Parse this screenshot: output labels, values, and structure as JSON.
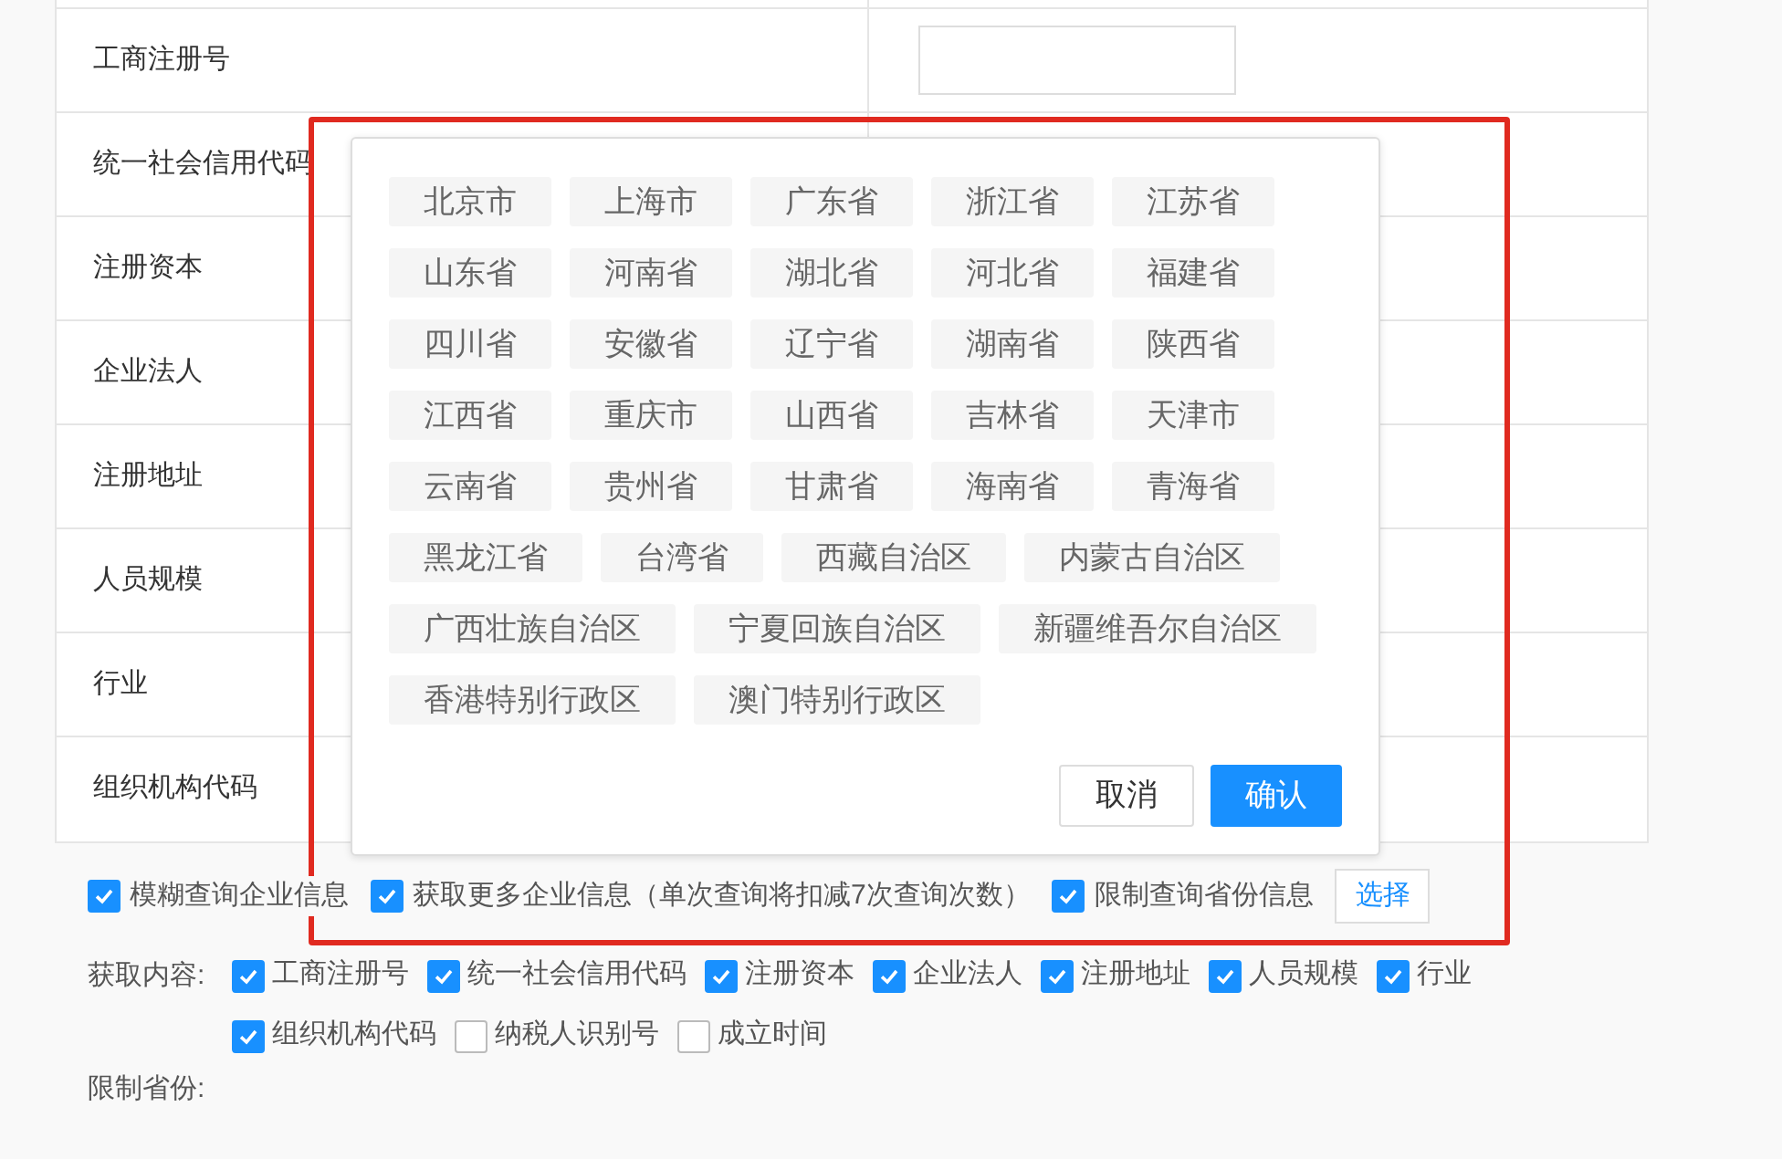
{
  "form_table": {
    "rows": [
      {
        "label": "工商注册号",
        "has_input": true
      },
      {
        "label": "统一社会信用代码"
      },
      {
        "label": "注册资本"
      },
      {
        "label": "企业法人"
      },
      {
        "label": "注册地址"
      },
      {
        "label": "人员规模"
      },
      {
        "label": "行业"
      },
      {
        "label": "组织机构代码"
      }
    ]
  },
  "options": [
    {
      "label": "模糊查询企业信息",
      "checked": true
    },
    {
      "label": "获取更多企业信息（单次查询将扣减7次查询次数）",
      "checked": true
    },
    {
      "label": "限制查询省份信息",
      "checked": true
    }
  ],
  "select_button": "选择",
  "fetch_content": {
    "label": "获取内容:",
    "items": [
      {
        "label": "工商注册号",
        "checked": true
      },
      {
        "label": "统一社会信用代码",
        "checked": true
      },
      {
        "label": "注册资本",
        "checked": true
      },
      {
        "label": "企业法人",
        "checked": true
      },
      {
        "label": "注册地址",
        "checked": true
      },
      {
        "label": "人员规模",
        "checked": true
      },
      {
        "label": "行业",
        "checked": true
      },
      {
        "label": "组织机构代码",
        "checked": true
      },
      {
        "label": "纳税人识别号",
        "checked": false
      },
      {
        "label": "成立时间",
        "checked": false
      }
    ]
  },
  "province_limit": {
    "label": "限制省份:"
  },
  "province_popup": {
    "provinces": [
      "北京市",
      "上海市",
      "广东省",
      "浙江省",
      "江苏省",
      "山东省",
      "河南省",
      "湖北省",
      "河北省",
      "福建省",
      "四川省",
      "安徽省",
      "辽宁省",
      "湖南省",
      "陕西省",
      "江西省",
      "重庆市",
      "山西省",
      "吉林省",
      "天津市",
      "云南省",
      "贵州省",
      "甘肃省",
      "海南省",
      "青海省",
      "黑龙江省",
      "台湾省",
      "西藏自治区",
      "内蒙古自治区",
      "广西壮族自治区",
      "宁夏回族自治区",
      "新疆维吾尔自治区",
      "香港特别行政区",
      "澳门特别行政区"
    ],
    "cancel": "取消",
    "confirm": "确认"
  },
  "highlight_frame": true
}
